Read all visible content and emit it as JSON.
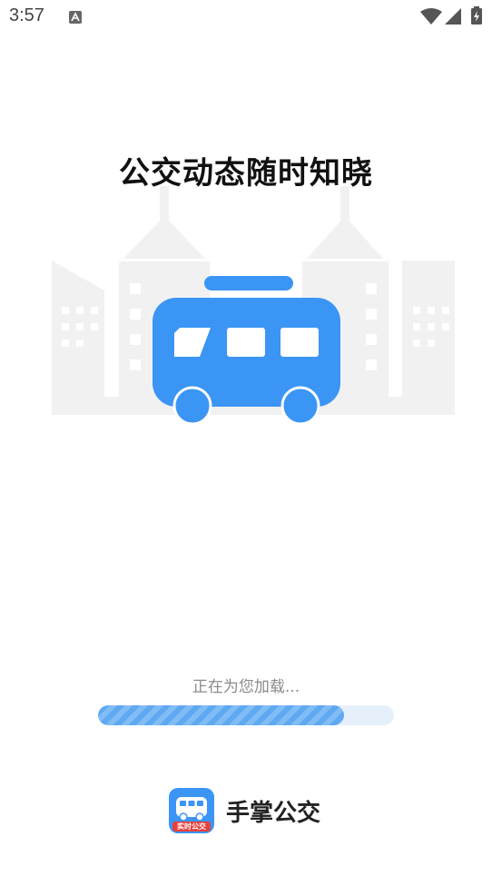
{
  "status_bar": {
    "time": "3:57",
    "notification_icon": "a-notification-icon",
    "wifi_icon": "wifi-icon",
    "signal_icon": "signal-icon",
    "battery_icon": "battery-charging-icon"
  },
  "splash": {
    "headline": "公交动态随时知晓",
    "loading_text": "正在为您加载...",
    "progress": 0.83,
    "illustration_icon": "bus-icon",
    "background_icon": "city-buildings-icon"
  },
  "app": {
    "name": "手掌公交",
    "icon_badge": "实时公交",
    "icon": "bus-app-icon"
  },
  "colors": {
    "accent": "#3b95f5",
    "progress_fill": "#5fa9f2",
    "progress_track": "#e6f0fb",
    "building": "#f1f1f1",
    "badge": "#e8403a"
  }
}
